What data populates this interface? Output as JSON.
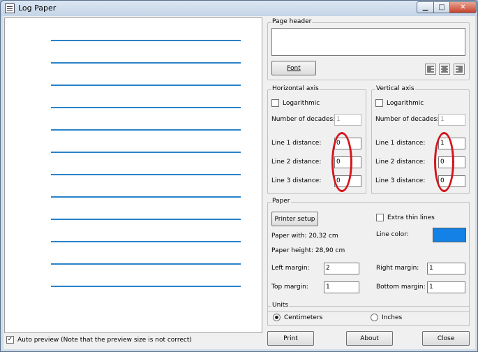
{
  "window": {
    "title": "Log Paper",
    "min_glyph": "▁",
    "max_glyph": "□",
    "close_glyph": "✕"
  },
  "preview": {
    "line_count": 12,
    "line_color": "#2a82c8"
  },
  "auto_preview": {
    "checked": true,
    "label": "Auto preview (Note that the preview size is not correct)"
  },
  "page_header": {
    "label": "Page header",
    "text": "",
    "font_button": "Font",
    "alignment": [
      "left",
      "center",
      "right"
    ]
  },
  "horizontal_axis": {
    "label": "Horizontal axis",
    "logarithmic": {
      "checked": false,
      "label": "Logarithmic"
    },
    "decades": {
      "label": "Number of decades:",
      "value": "1"
    },
    "line1": {
      "label": "Line 1 distance:",
      "value": "0"
    },
    "line2": {
      "label": "Line 2 distance:",
      "value": "0"
    },
    "line3": {
      "label": "Line 3 distance:",
      "value": "0"
    }
  },
  "vertical_axis": {
    "label": "Vertical axis",
    "logarithmic": {
      "checked": false,
      "label": "Logarithmic"
    },
    "decades": {
      "label": "Number of decades:",
      "value": "1"
    },
    "line1": {
      "label": "Line 1 distance:",
      "value": "1"
    },
    "line2": {
      "label": "Line 2 distance:",
      "value": "0"
    },
    "line3": {
      "label": "Line 3 distance:",
      "value": "0"
    }
  },
  "paper": {
    "label": "Paper",
    "printer_setup": "Printer setup",
    "extra_thin_lines": {
      "checked": false,
      "label": "Extra thin lines"
    },
    "line_color": {
      "label": "Line color:",
      "value": "#1381e6"
    },
    "paper_width": "Paper with: 20,32 cm",
    "paper_height": "Paper height: 28,90 cm",
    "left_margin": {
      "label": "Left margin:",
      "value": "2"
    },
    "right_margin": {
      "label": "Right margin:",
      "value": "1"
    },
    "top_margin": {
      "label": "Top margin:",
      "value": "1"
    },
    "bottom_margin": {
      "label": "Bottom margin:",
      "value": "1"
    }
  },
  "units": {
    "label": "Units",
    "centimeters": {
      "selected": true,
      "label": "Centimeters"
    },
    "inches": {
      "selected": false,
      "label": "Inches"
    }
  },
  "buttons": {
    "print": "Print",
    "about": "About",
    "close": "Close"
  },
  "highlight_color": "#d7141c"
}
